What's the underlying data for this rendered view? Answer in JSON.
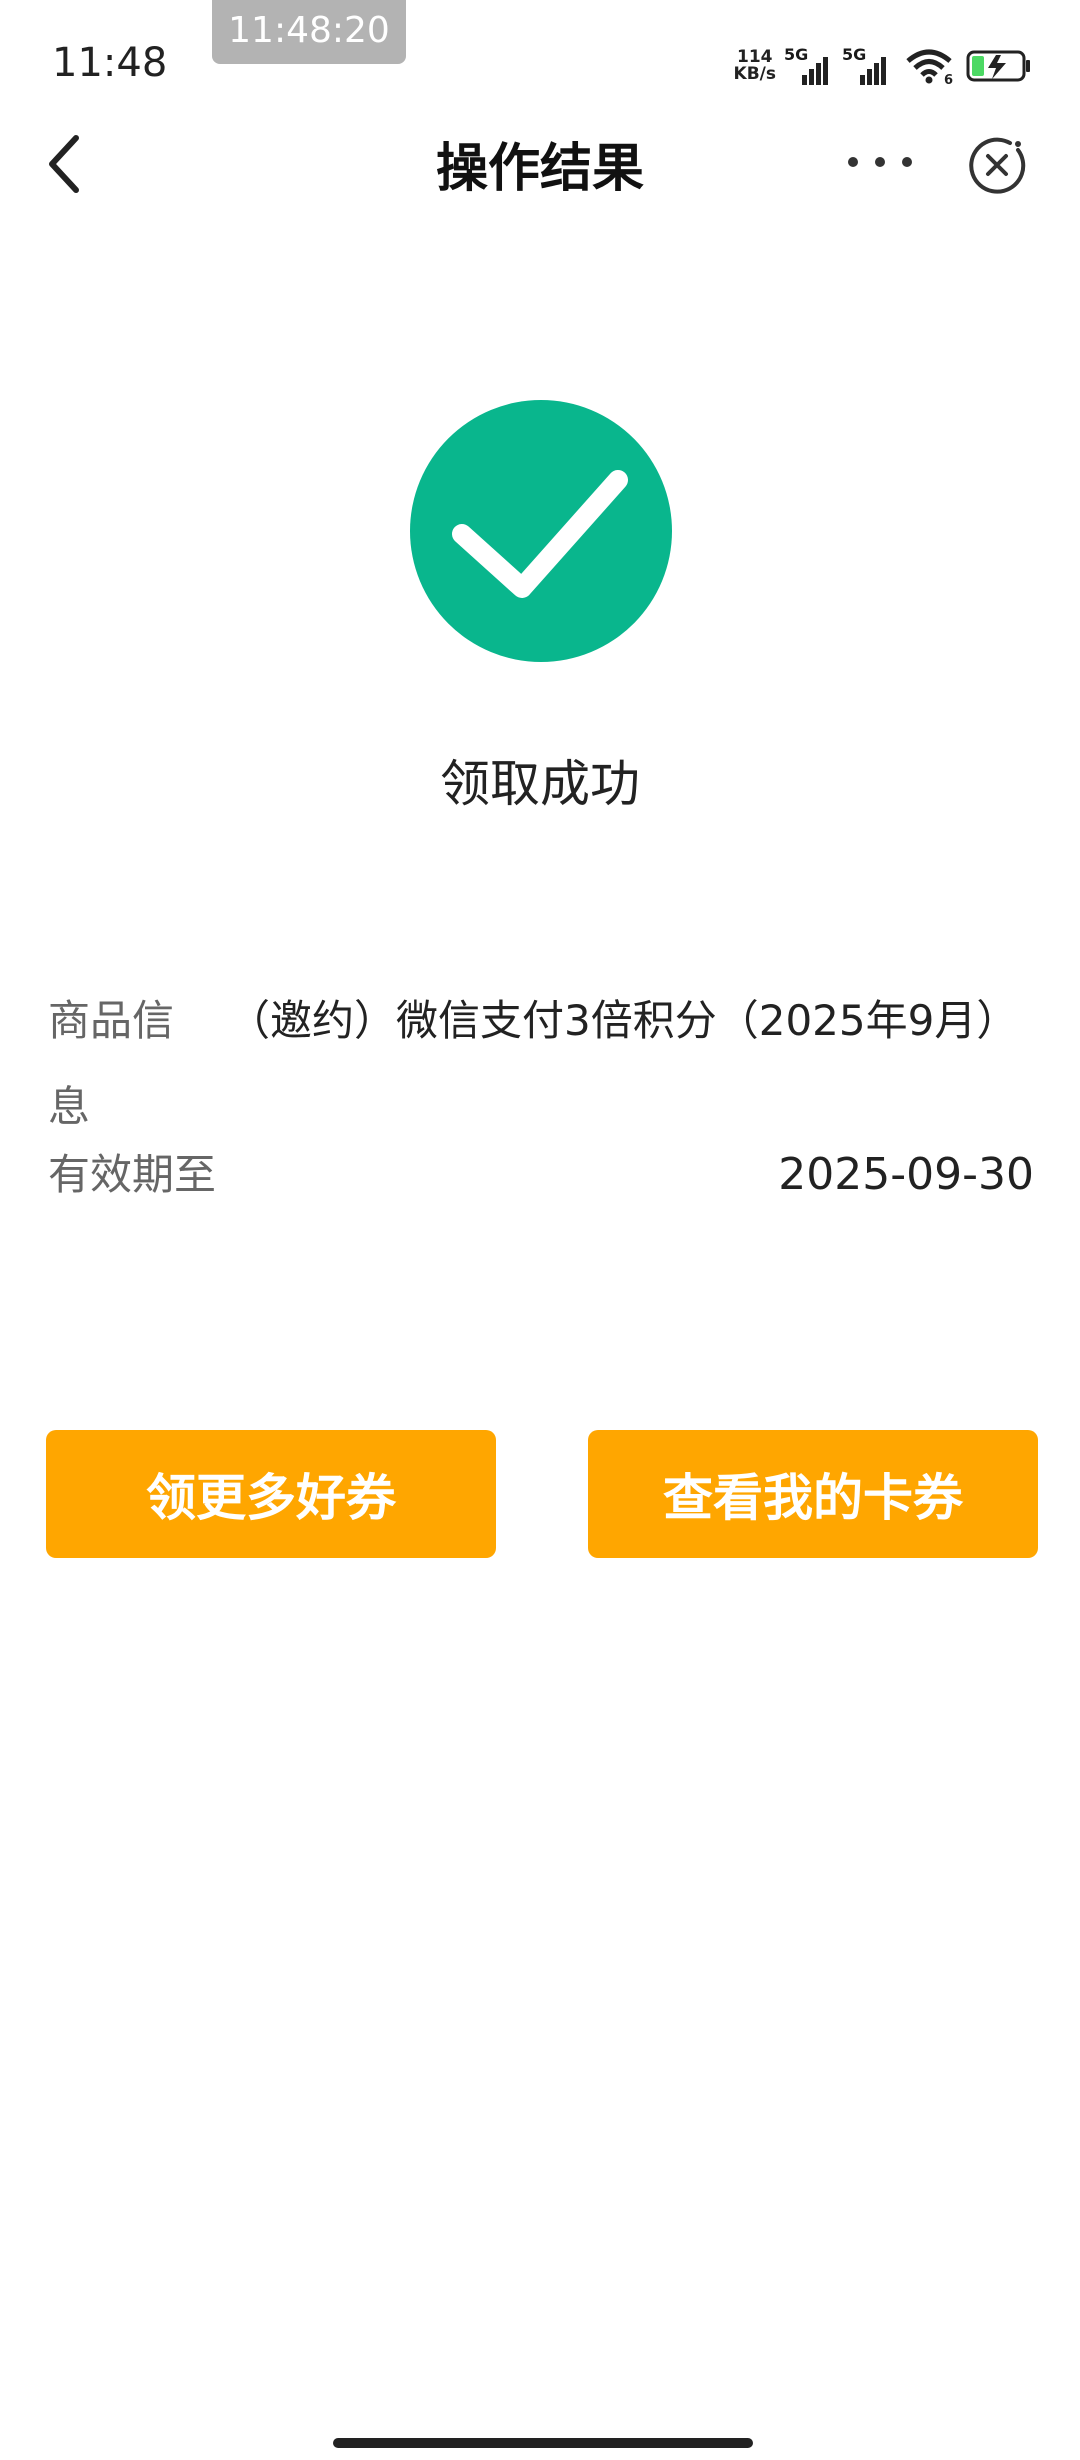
{
  "status_bar": {
    "time": "11:48",
    "screenshot_clock": "11:48:20",
    "net_speed_value": "114",
    "net_speed_unit": "KB/s",
    "sim1_label": "5G",
    "sim2_label": "5G",
    "wifi_badge": "6",
    "icons": [
      "signal-icon",
      "wifi-icon",
      "battery-charging-icon"
    ]
  },
  "nav": {
    "title": "操作结果",
    "back_icon": "chevron-left-icon",
    "more_icon": "more-dots-icon",
    "close_icon": "close-circle-icon"
  },
  "result": {
    "icon": "check-circle-icon",
    "icon_color": "#09b68d",
    "message": "领取成功"
  },
  "details": {
    "goods_label": "商品信息",
    "goods_value": "（邀约）微信支付3倍积分（2025年9月）",
    "valid_label": "有效期至",
    "valid_value": "2025-09-30"
  },
  "actions": {
    "more_coupons_label": "领更多好券",
    "my_coupons_label": "查看我的卡券",
    "button_color": "#ffa600"
  }
}
